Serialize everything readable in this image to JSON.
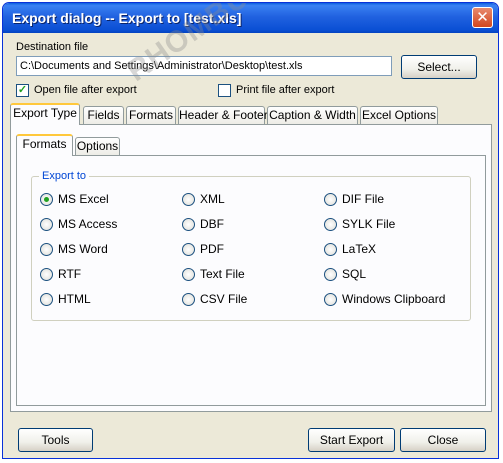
{
  "window": {
    "title": "Export dialog -- Export to [test.xls]",
    "close_icon": "close-icon"
  },
  "destination": {
    "label": "Destination file",
    "path": "C:\\Documents and Settings\\Administrator\\Desktop\\test.xls",
    "select_label": "Select..."
  },
  "options": {
    "open_after_label": "Open file after export",
    "open_after_checked": true,
    "print_after_label": "Print file after export",
    "print_after_checked": false
  },
  "tabs": [
    "Export Type",
    "Fields",
    "Formats",
    "Header & Footer",
    "Caption & Width",
    "Excel Options"
  ],
  "subtabs": [
    "Formats",
    "Options"
  ],
  "export_to": {
    "title": "Export to",
    "selected": "MS Excel",
    "col1": [
      "MS Excel",
      "MS Access",
      "MS Word",
      "RTF",
      "HTML"
    ],
    "col2": [
      "XML",
      "DBF",
      "PDF",
      "Text File",
      "CSV File"
    ],
    "col3": [
      "DIF File",
      "SYLK File",
      "LaTeX",
      "SQL",
      "Windows Clipboard"
    ]
  },
  "footer": {
    "tools_label": "Tools",
    "start_label": "Start Export",
    "close_label": "Close"
  },
  "watermark": "RHOMBUS"
}
